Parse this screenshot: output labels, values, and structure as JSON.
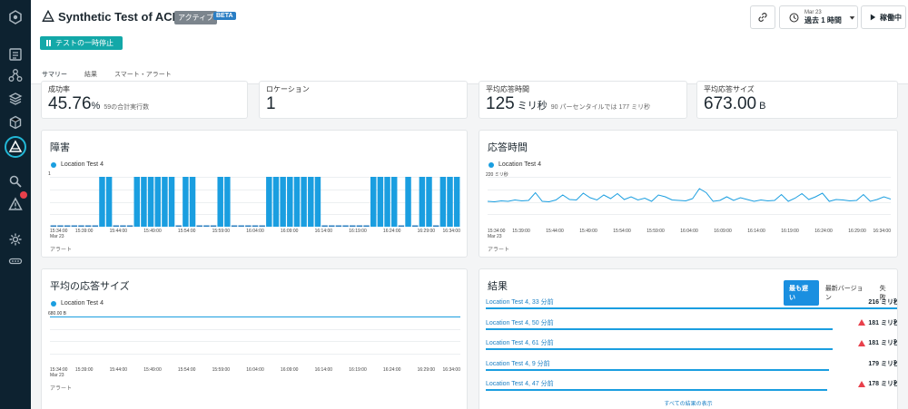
{
  "header": {
    "title": "Synthetic Test of ACE Flow",
    "status": "アクティブ",
    "beta": "BETA",
    "pause_label": "テストの一時停止",
    "time_date": "Mar 23",
    "time_range": "過去 1 時間",
    "run_label": "稼働中"
  },
  "tabs": [
    "サマリー",
    "結果",
    "スマート・アラート"
  ],
  "kpis": [
    {
      "label": "成功率",
      "value": "45.76",
      "unit": "%",
      "sub": "59の合計実行数"
    },
    {
      "label": "ロケーション",
      "value": "1",
      "unit": "",
      "sub": ""
    },
    {
      "label": "平均応答時間",
      "value": "125",
      "unit": " ミリ秒",
      "sub": "90 パーセンタイルでは 177 ミリ秒"
    },
    {
      "label": "平均応答サイズ",
      "value": "673.00",
      "unit": " B",
      "sub": ""
    }
  ],
  "x_ticks_first": "15:34:00",
  "x_ticks_sub": "Mar 23",
  "alert_label": "アラート",
  "charts": {
    "failures": {
      "title": "障害",
      "legend": "Location Test 4",
      "ymax_label": "1"
    },
    "response_time": {
      "title": "応答時間",
      "legend": "Location Test 4",
      "ymax_label": "220 ミリ秒"
    },
    "response_size": {
      "title": "平均の応答サイズ",
      "legend": "Location Test 4",
      "ymax_label": "680.00 B"
    }
  },
  "chart_data": [
    {
      "type": "bar",
      "title": "障害",
      "series": [
        {
          "name": "Location Test 4",
          "values": [
            0,
            0,
            0,
            0,
            0,
            0,
            0,
            1,
            1,
            0,
            0,
            0,
            1,
            1,
            1,
            1,
            1,
            1,
            0,
            1,
            1,
            0,
            0,
            0,
            1,
            1,
            0,
            0,
            0,
            0,
            0,
            1,
            1,
            1,
            1,
            1,
            1,
            1,
            1,
            0,
            0,
            0,
            0,
            0,
            0,
            0,
            1,
            1,
            1,
            1,
            0,
            1,
            0,
            1,
            1,
            0,
            1,
            1,
            1
          ]
        }
      ],
      "x_ticks": [
        "15:34:00",
        "15:39:00",
        "15:44:00",
        "15:49:00",
        "15:54:00",
        "15:59:00",
        "16:04:00",
        "16:09:00",
        "16:14:00",
        "16:19:00",
        "16:24:00",
        "16:29:00",
        "16:34:00"
      ],
      "ylim": [
        0,
        1
      ]
    },
    {
      "type": "line",
      "title": "応答時間",
      "series": [
        {
          "name": "Location Test 4",
          "values": [
            112,
            110,
            114,
            112,
            118,
            114,
            116,
            150,
            112,
            110,
            118,
            140,
            120,
            118,
            148,
            128,
            118,
            140,
            124,
            146,
            120,
            132,
            118,
            126,
            112,
            140,
            132,
            118,
            116,
            114,
            124,
            168,
            150,
            112,
            116,
            132,
            116,
            128,
            120,
            112,
            118,
            114,
            116,
            142,
            112,
            126,
            146,
            120,
            132,
            148,
            112,
            120,
            118,
            114,
            116,
            142,
            112,
            120,
            132,
            122
          ]
        }
      ],
      "x_ticks": [
        "15:34:00",
        "15:39:00",
        "15:44:00",
        "15:49:00",
        "15:54:00",
        "15:59:00",
        "16:04:00",
        "16:09:00",
        "16:14:00",
        "16:19:00",
        "16:24:00",
        "16:29:00",
        "16:34:00"
      ],
      "ylim": [
        0,
        220
      ]
    },
    {
      "type": "line",
      "title": "平均の応答サイズ",
      "series": [
        {
          "name": "Location Test 4",
          "values": [
            673,
            673,
            673,
            673,
            673,
            673,
            673,
            673,
            673,
            673,
            673,
            673,
            673,
            673,
            673,
            673,
            673,
            673,
            673,
            673,
            673,
            673,
            673,
            673,
            673,
            673,
            673,
            673,
            673,
            673
          ]
        }
      ],
      "x_ticks": [
        "15:34:00",
        "15:39:00",
        "15:44:00",
        "15:49:00",
        "15:54:00",
        "15:59:00",
        "16:04:00",
        "16:09:00",
        "16:14:00",
        "16:19:00",
        "16:24:00",
        "16:29:00",
        "16:34:00"
      ],
      "ylim": [
        0,
        680
      ]
    }
  ],
  "results": {
    "title": "結果",
    "toggles": [
      "最も遅い",
      "最新バージョン",
      "失敗"
    ],
    "rows": [
      {
        "name": "Location Test 4, 33 分前",
        "value": "216 ミリ秒",
        "warn": false,
        "ratio": 1.0
      },
      {
        "name": "Location Test 4, 50 分前",
        "value": "181 ミリ秒",
        "warn": true,
        "ratio": 0.838
      },
      {
        "name": "Location Test 4, 61 分前",
        "value": "181 ミリ秒",
        "warn": true,
        "ratio": 0.838
      },
      {
        "name": "Location Test 4, 9 分前",
        "value": "179 ミリ秒",
        "warn": false,
        "ratio": 0.829
      },
      {
        "name": "Location Test 4, 47 分前",
        "value": "178 ミリ秒",
        "warn": true,
        "ratio": 0.824
      }
    ],
    "view_all": "すべての結果の表示"
  }
}
